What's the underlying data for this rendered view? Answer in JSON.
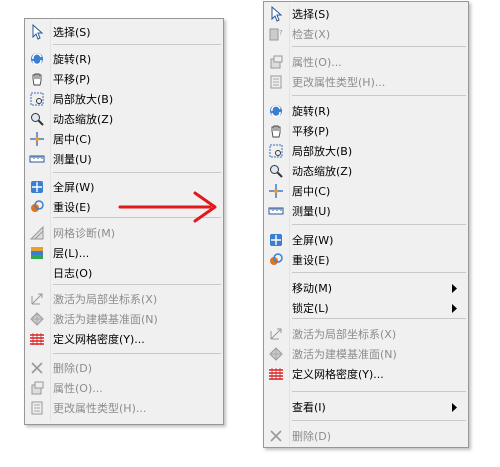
{
  "left_menu": {
    "items": [
      {
        "label": "选择(S)",
        "icon": "cursor-icon",
        "disabled": false
      },
      {
        "label": "旋转(R)",
        "icon": "rotate-icon",
        "disabled": false
      },
      {
        "label": "平移(P)",
        "icon": "hand-icon",
        "disabled": false
      },
      {
        "label": "局部放大(B)",
        "icon": "zoom-box-icon",
        "disabled": false
      },
      {
        "label": "动态缩放(Z)",
        "icon": "zoom-dynamic-icon",
        "disabled": false
      },
      {
        "label": "居中(C)",
        "icon": "center-icon",
        "disabled": false
      },
      {
        "label": "测量(U)",
        "icon": "ruler-icon",
        "disabled": false
      },
      {
        "label": "全屏(W)",
        "icon": "fullscreen-icon",
        "disabled": false
      },
      {
        "label": "重设(E)",
        "icon": "reset-icon",
        "disabled": false
      },
      {
        "label": "网格诊断(M)",
        "icon": "mesh-diagnose-icon",
        "disabled": true
      },
      {
        "label": "层(L)...",
        "icon": "layers-icon",
        "disabled": false
      },
      {
        "label": "日志(O)",
        "icon": "",
        "disabled": false
      },
      {
        "label": "激活为局部坐标系(X)",
        "icon": "local-coord-icon",
        "disabled": true
      },
      {
        "label": "激活为建模基准面(N)",
        "icon": "datum-plane-icon",
        "disabled": true
      },
      {
        "label": "定义网格密度(Y)...",
        "icon": "mesh-density-icon",
        "disabled": false
      },
      {
        "label": "删除(D)",
        "icon": "delete-icon",
        "disabled": true
      },
      {
        "label": "属性(O)...",
        "icon": "properties-icon",
        "disabled": true
      },
      {
        "label": "更改属性类型(H)...",
        "icon": "change-property-icon",
        "disabled": true
      }
    ]
  },
  "right_menu": {
    "items": [
      {
        "label": "选择(S)",
        "icon": "cursor-icon",
        "disabled": false
      },
      {
        "label": "检查(X)",
        "icon": "check-icon",
        "disabled": true
      },
      {
        "label": "属性(O)...",
        "icon": "properties-icon",
        "disabled": true
      },
      {
        "label": "更改属性类型(H)...",
        "icon": "change-property-icon",
        "disabled": true
      },
      {
        "label": "旋转(R)",
        "icon": "rotate-icon",
        "disabled": false
      },
      {
        "label": "平移(P)",
        "icon": "hand-icon",
        "disabled": false
      },
      {
        "label": "局部放大(B)",
        "icon": "zoom-box-icon",
        "disabled": false
      },
      {
        "label": "动态缩放(Z)",
        "icon": "zoom-dynamic-icon",
        "disabled": false
      },
      {
        "label": "居中(C)",
        "icon": "center-icon",
        "disabled": false
      },
      {
        "label": "测量(U)",
        "icon": "ruler-icon",
        "disabled": false
      },
      {
        "label": "全屏(W)",
        "icon": "fullscreen-icon",
        "disabled": false
      },
      {
        "label": "重设(E)",
        "icon": "reset-icon",
        "disabled": false
      },
      {
        "label": "移动(M)",
        "icon": "",
        "disabled": false,
        "submenu": true
      },
      {
        "label": "锁定(L)",
        "icon": "",
        "disabled": false,
        "submenu": true
      },
      {
        "label": "激活为局部坐标系(X)",
        "icon": "local-coord-icon",
        "disabled": true
      },
      {
        "label": "激活为建模基准面(N)",
        "icon": "datum-plane-icon",
        "disabled": true
      },
      {
        "label": "定义网格密度(Y)...",
        "icon": "mesh-density-icon",
        "disabled": false
      },
      {
        "label": "查看(I)",
        "icon": "",
        "disabled": false,
        "submenu": true
      },
      {
        "label": "删除(D)",
        "icon": "delete-icon",
        "disabled": true
      }
    ]
  },
  "colors": {
    "arrow": "#e0191c",
    "menu_bg": "#f0f0f0",
    "disabled_text": "#8d8d8d"
  }
}
